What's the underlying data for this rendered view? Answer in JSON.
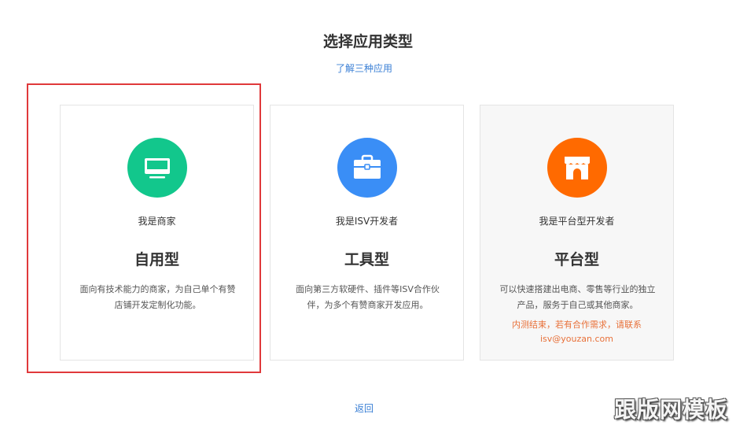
{
  "page": {
    "title": "选择应用类型",
    "learn_link": "了解三种应用",
    "back_link": "返回"
  },
  "cards": [
    {
      "role": "我是商家",
      "type": "自用型",
      "description": "面向有技术能力的商家，为自己单个有赞店铺开发定制化功能。",
      "icon": "monitor-icon",
      "color": "#12c78c",
      "selected": true
    },
    {
      "role": "我是ISV开发者",
      "type": "工具型",
      "description": "面向第三方软硬件、插件等ISV合作伙伴，为多个有赞商家开发应用。",
      "icon": "briefcase-icon",
      "color": "#3a8ef6"
    },
    {
      "role": "我是平台型开发者",
      "type": "平台型",
      "description": "可以快速搭建出电商、零售等行业的独立产品，服务于自己或其他商家。",
      "notice_line1": "内测结束，若有合作需求，请联系",
      "notice_line2": "isv@youzan.com",
      "icon": "storefront-icon",
      "color": "#ff6a00",
      "disabled": true
    }
  ],
  "watermark": "跟版网模板"
}
